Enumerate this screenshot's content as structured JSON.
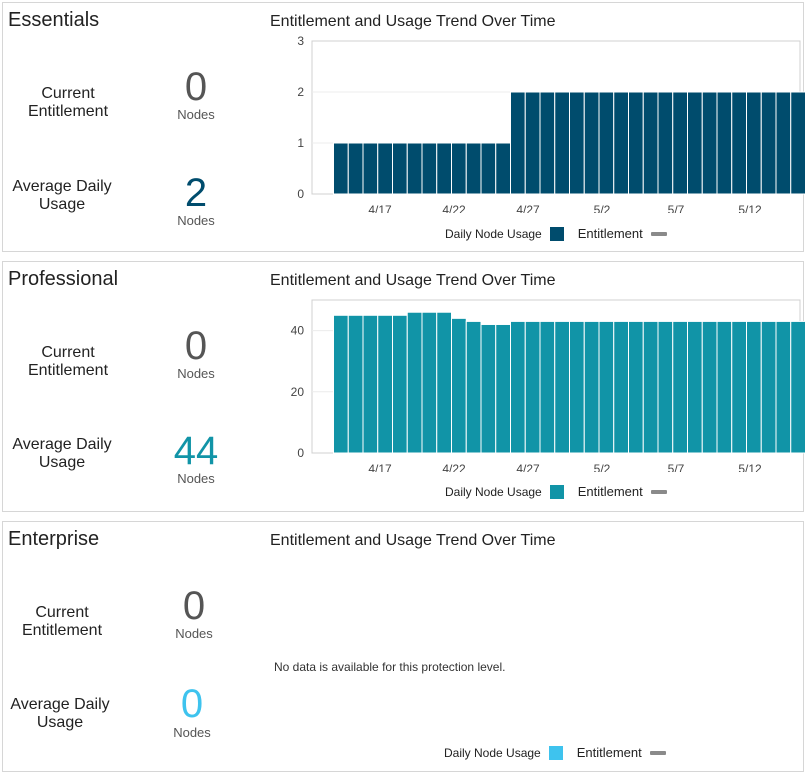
{
  "unit_label": "Nodes",
  "current_label": "Current Entitlement",
  "avg_label": "Average Daily Usage",
  "chart_title": "Entitlement and Usage Trend Over Time",
  "legend": {
    "usage": "Daily Node Usage",
    "entitlement": "Entitlement"
  },
  "no_data_text": "No data is available for this protection level.",
  "colors": {
    "essentials": "#004c6d",
    "professional": "#1194a7",
    "enterprise": "#3ec3ee",
    "entitlement": "#8a8a8a"
  },
  "panels": [
    {
      "id": "essentials",
      "title": "Essentials",
      "current_entitlement": "0",
      "average_daily_usage": "2"
    },
    {
      "id": "professional",
      "title": "Professional",
      "current_entitlement": "0",
      "average_daily_usage": "44"
    },
    {
      "id": "enterprise",
      "title": "Enterprise",
      "current_entitlement": "0",
      "average_daily_usage": "0"
    }
  ],
  "chart_data": [
    {
      "type": "bar",
      "title": "Entitlement and Usage Trend Over Time",
      "x_ticks": [
        "4/17",
        "4/22",
        "4/27",
        "5/2",
        "5/7",
        "5/12"
      ],
      "ylim": [
        0,
        3
      ],
      "y_ticks": [
        0,
        1,
        2,
        3
      ],
      "series": [
        {
          "name": "Daily Node Usage",
          "values": [
            1,
            1,
            1,
            1,
            1,
            1,
            1,
            1,
            1,
            1,
            1,
            1,
            2,
            2,
            2,
            2,
            2,
            2,
            2,
            2,
            2,
            2,
            2,
            2,
            2,
            2,
            2,
            2,
            2,
            2,
            2,
            2
          ]
        },
        {
          "name": "Entitlement",
          "values": []
        }
      ]
    },
    {
      "type": "bar",
      "title": "Entitlement and Usage Trend Over Time",
      "x_ticks": [
        "4/17",
        "4/22",
        "4/27",
        "5/2",
        "5/7",
        "5/12"
      ],
      "ylim": [
        0,
        50
      ],
      "y_ticks": [
        0,
        20,
        40
      ],
      "series": [
        {
          "name": "Daily Node Usage",
          "values": [
            45,
            45,
            45,
            45,
            45,
            46,
            46,
            46,
            44,
            43,
            42,
            42,
            43,
            43,
            43,
            43,
            43,
            43,
            43,
            43,
            43,
            43,
            43,
            43,
            43,
            43,
            43,
            43,
            43,
            43,
            43,
            43
          ]
        },
        {
          "name": "Entitlement",
          "values": []
        }
      ]
    }
  ]
}
